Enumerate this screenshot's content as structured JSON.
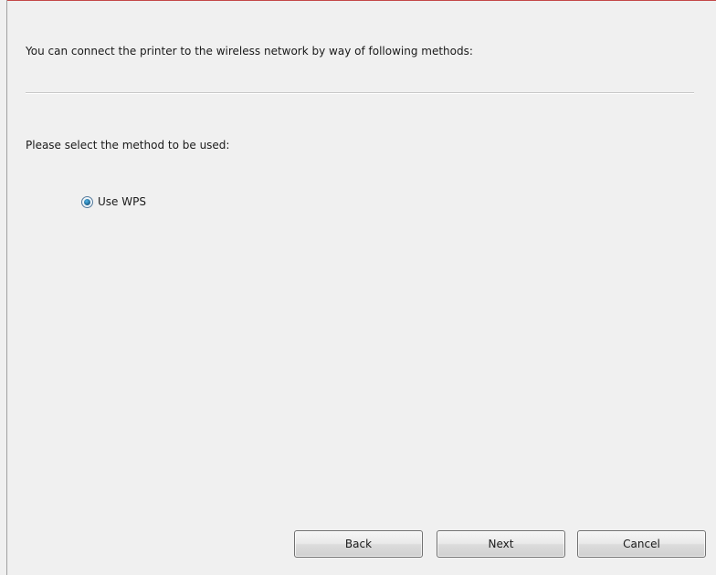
{
  "dialog": {
    "intro": "You can connect the printer to the wireless network by way of following methods:",
    "prompt": "Please select the method to be used:",
    "options": [
      {
        "label": "Use WPS",
        "selected": true
      }
    ]
  },
  "buttons": {
    "back": "Back",
    "next": "Next",
    "cancel": "Cancel"
  },
  "colors": {
    "background": "#f0f0f0",
    "accent_top_edge": "#c44848",
    "radio_selected": "#1a5f8a"
  }
}
